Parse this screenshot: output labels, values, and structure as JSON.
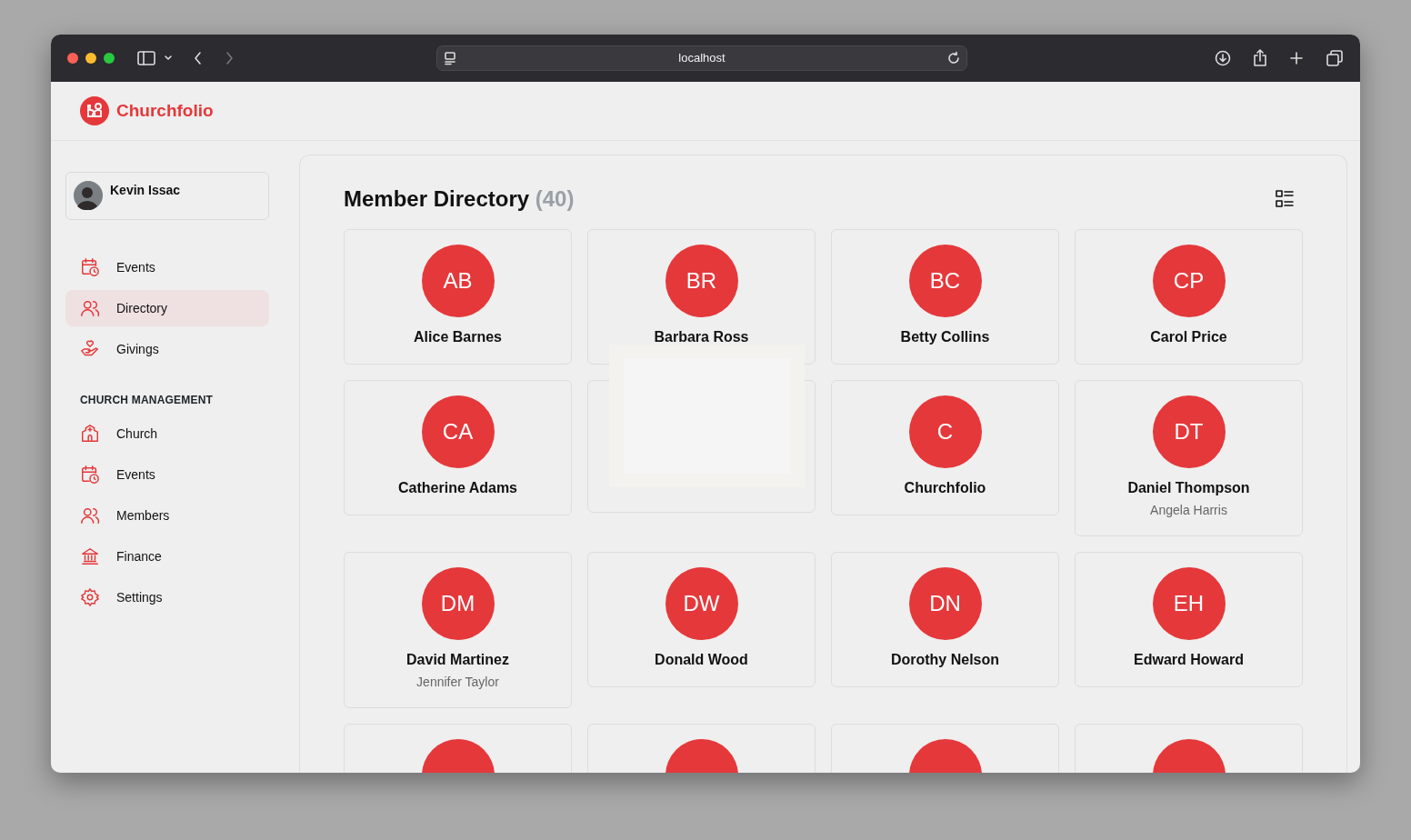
{
  "browser": {
    "url": "localhost"
  },
  "app": {
    "brand": "Churchfolio"
  },
  "user": {
    "name": "Kevin Issac"
  },
  "nav": [
    {
      "label": "Events",
      "selected": false
    },
    {
      "label": "Directory",
      "selected": true
    },
    {
      "label": "Givings",
      "selected": false
    }
  ],
  "management": {
    "title": "CHURCH MANAGEMENT",
    "items": [
      {
        "label": "Church",
        "selected": false
      },
      {
        "label": "Events",
        "selected": false
      },
      {
        "label": "Members",
        "selected": false
      },
      {
        "label": "Finance",
        "selected": false
      },
      {
        "label": "Settings",
        "selected": false
      }
    ]
  },
  "directory": {
    "title": "Member Directory",
    "count": "(40)",
    "members": [
      {
        "kind": "member",
        "initials": "AB",
        "name": "Alice Barnes"
      },
      {
        "kind": "member",
        "initials": "BR",
        "name": "Barbara Ross"
      },
      {
        "kind": "member",
        "initials": "BC",
        "name": "Betty Collins"
      },
      {
        "kind": "member",
        "initials": "CP",
        "name": "Carol Price"
      },
      {
        "kind": "member",
        "initials": "CA",
        "name": "Catherine Adams"
      },
      {
        "kind": "covered"
      },
      {
        "kind": "member",
        "initials": "C",
        "name": "Churchfolio"
      },
      {
        "kind": "member",
        "initials": "DT",
        "name": "Daniel Thompson",
        "subtitle": "Angela Harris"
      },
      {
        "kind": "member",
        "initials": "DM",
        "name": "David Martinez",
        "subtitle": "Jennifer Taylor"
      },
      {
        "kind": "member",
        "initials": "DW",
        "name": "Donald Wood"
      },
      {
        "kind": "member",
        "initials": "DN",
        "name": "Dorothy Nelson"
      },
      {
        "kind": "member",
        "initials": "EH",
        "name": "Edward Howard"
      },
      {
        "kind": "cut"
      },
      {
        "kind": "cut"
      },
      {
        "kind": "cut"
      },
      {
        "kind": "cut"
      }
    ]
  },
  "popup": {
    "shown": true
  }
}
